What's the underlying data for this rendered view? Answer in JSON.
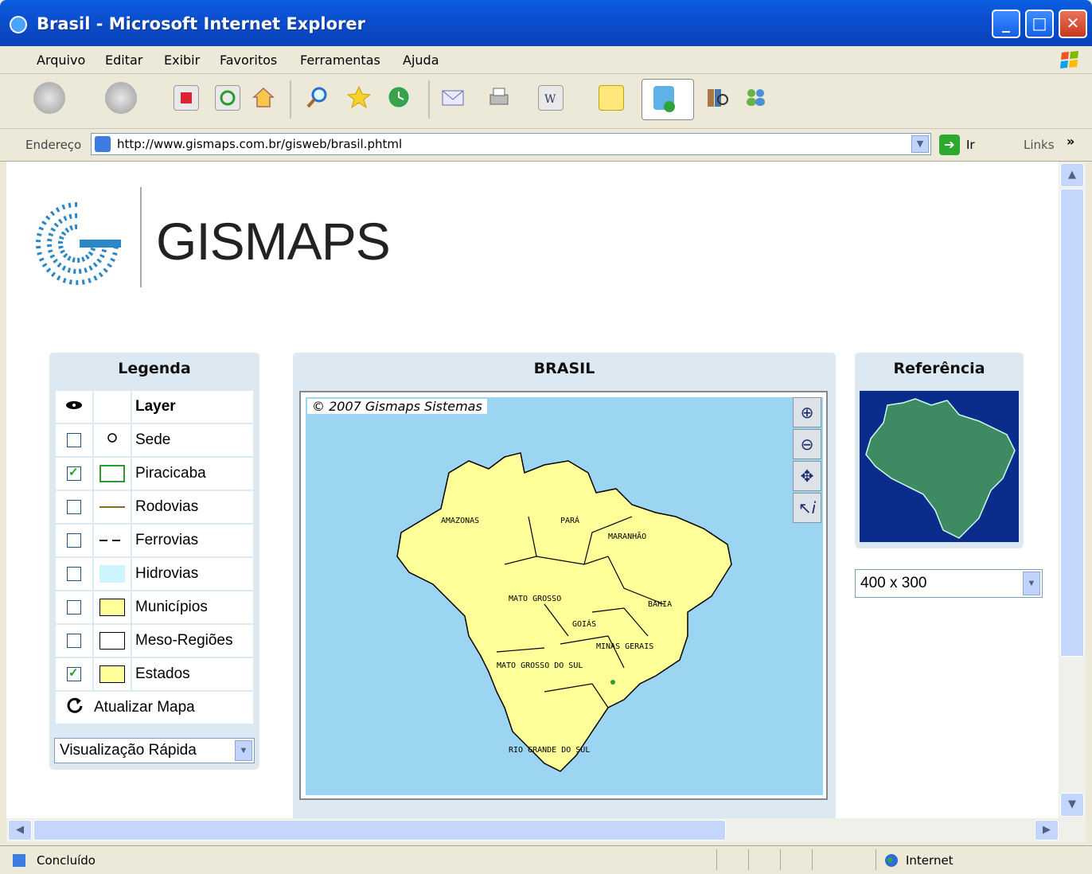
{
  "window": {
    "title": "Brasil - Microsoft Internet Explorer"
  },
  "menu": [
    "Arquivo",
    "Editar",
    "Exibir",
    "Favoritos",
    "Ferramentas",
    "Ajuda"
  ],
  "address": {
    "label": "Endereço",
    "url": "http://www.gismaps.com.br/gisweb/brasil.phtml",
    "go": "Ir",
    "links": "Links"
  },
  "page": {
    "logo_text": "GISMAPS",
    "legend": {
      "title": "Legenda",
      "header": "Layer",
      "items": [
        {
          "label": "Sede",
          "checked": false
        },
        {
          "label": "Piracicaba",
          "checked": true
        },
        {
          "label": "Rodovias",
          "checked": false
        },
        {
          "label": "Ferrovias",
          "checked": false
        },
        {
          "label": "Hidrovias",
          "checked": false
        },
        {
          "label": "Municípios",
          "checked": false
        },
        {
          "label": "Meso-Regiões",
          "checked": false
        },
        {
          "label": "Estados",
          "checked": true
        }
      ],
      "refresh": "Atualizar Mapa",
      "quick_view": "Visualização Rápida"
    },
    "map": {
      "title": "BRASIL",
      "copyright": "© 2007 Gismaps Sistemas",
      "labels": [
        "AMAZONAS",
        "PARÁ",
        "MARANHÃO",
        "MATO GROSSO",
        "BAHIA",
        "GOIÁS",
        "MINAS GERAIS",
        "MATO GROSSO DO SUL",
        "RIO GRANDE DO SUL"
      ],
      "ocean_color": "#9cd5f2",
      "land_color": "#ffff99"
    },
    "reference": {
      "title": "Referência",
      "size": "400 x 300"
    }
  },
  "status": {
    "text": "Concluído",
    "zone": "Internet"
  }
}
